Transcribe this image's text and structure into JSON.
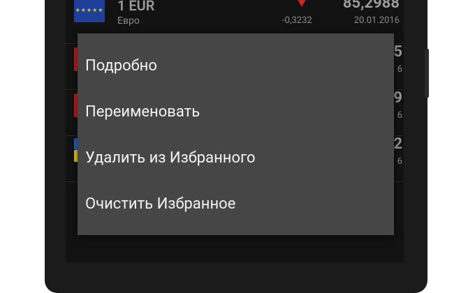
{
  "list": {
    "first_row": {
      "code": "1 EUR",
      "name": "Евро",
      "change": "-0,3232",
      "rate": "85,2988",
      "date": "20.01.2016",
      "trend": "down"
    },
    "partial_rows": [
      {
        "rate_tail": "5",
        "date_tail": "6"
      },
      {
        "rate_tail": "9",
        "date_tail": "6"
      },
      {
        "rate_tail": "2",
        "date_tail": "6"
      }
    ]
  },
  "context_menu": {
    "items": [
      {
        "label": "Подробно"
      },
      {
        "label": "Переименовать"
      },
      {
        "label": "Удалить из Избранного"
      },
      {
        "label": "Очистить Избранное"
      }
    ]
  },
  "colors": {
    "menu_bg": "#464646",
    "screen_bg": "#121212",
    "trend_down": "#c62828"
  }
}
